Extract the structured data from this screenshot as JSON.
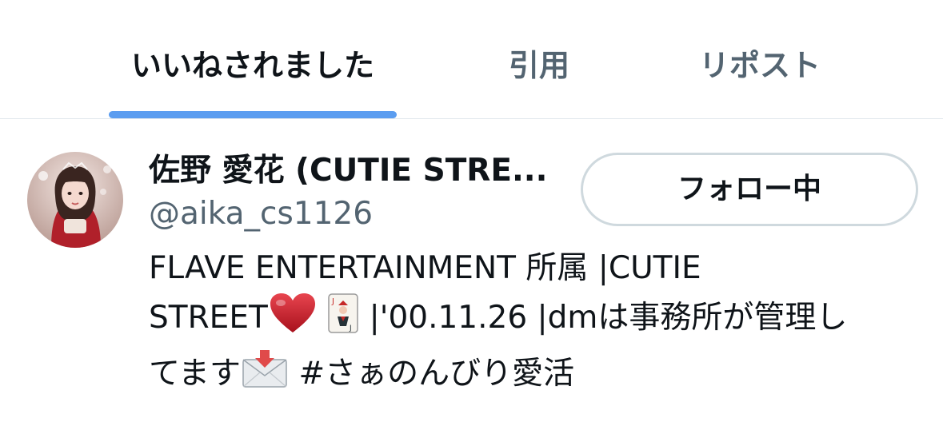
{
  "tabs": [
    {
      "label": "いいねされました",
      "active": true
    },
    {
      "label": "引用",
      "active": false
    },
    {
      "label": "リポスト",
      "active": false
    }
  ],
  "user": {
    "display_name": "佐野 愛花 (CUTIE STRE...",
    "handle": "@aika_cs1126",
    "follow_button": "フォロー中",
    "bio": {
      "line1": "FLAVE ENTERTAINMENT 所属 |CUTIE",
      "line2_a": "STREET",
      "line2_b": " |'00.11.26 |dmは事務所が管理し",
      "line3_a": "てます",
      "line3_b": " #さぁのんびり愛活"
    }
  },
  "icons": [
    "heart-emoji-icon",
    "joker-card-emoji-icon",
    "envelope-arrow-emoji-icon"
  ],
  "colors": {
    "accent": "#5b9df0",
    "text": "#0f1419",
    "secondary_text": "#536471",
    "border": "#cfd9de",
    "heart": "#d7263d"
  }
}
